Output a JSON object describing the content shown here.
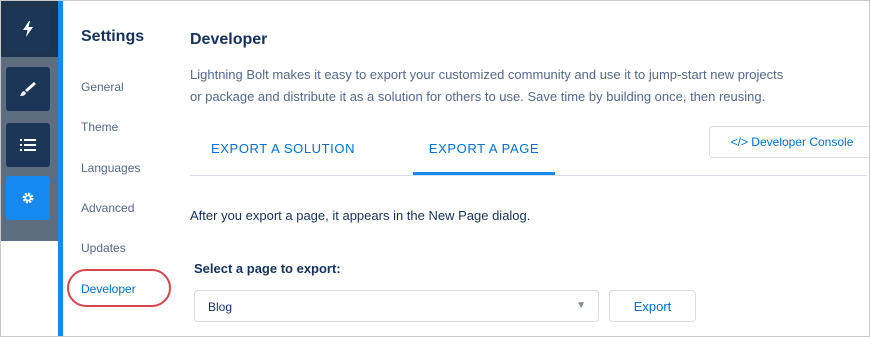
{
  "rail": {
    "items": [
      {
        "icon": "lightning-bolt-icon"
      },
      {
        "icon": "brush-icon"
      },
      {
        "icon": "list-icon"
      },
      {
        "icon": "gear-icon",
        "active": true
      }
    ]
  },
  "settings": {
    "title": "Settings",
    "items": [
      {
        "label": "General"
      },
      {
        "label": "Theme"
      },
      {
        "label": "Languages"
      },
      {
        "label": "Advanced"
      },
      {
        "label": "Updates"
      },
      {
        "label": "Developer",
        "active": true
      }
    ]
  },
  "main": {
    "title": "Developer",
    "description_line1": "Lightning Bolt makes it easy to export your customized community and use it to jump-start new projects",
    "description_line2": "or package  and distribute it as a solution for others to use. Save time by building once, then reusing.",
    "tabs": [
      {
        "label": "EXPORT A SOLUTION"
      },
      {
        "label": "EXPORT A PAGE",
        "active": true
      }
    ],
    "console_button": "</> Developer Console",
    "info_text": "After you export a page, it appears in the New Page dialog.",
    "select_label": "Select a page to export:",
    "select_value": "Blog",
    "export_button": "Export"
  },
  "colors": {
    "accent": "#1589ee",
    "link": "#0070d2",
    "rail_dark": "#1b3656",
    "highlight": "#d8454c"
  }
}
